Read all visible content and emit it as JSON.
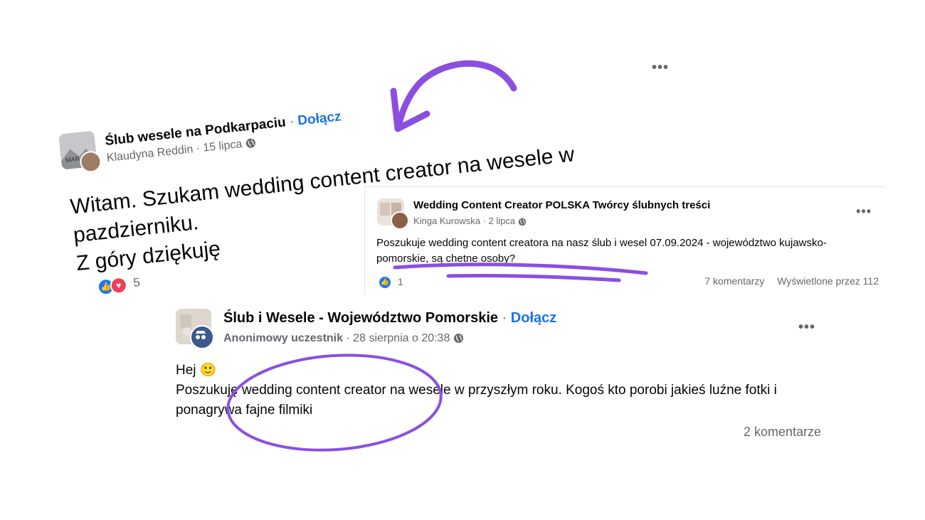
{
  "post1": {
    "group": "Ślub wesele na Podkarpaciu",
    "separator": " · ",
    "join": "Dołącz",
    "author": "Klaudyna Reddin",
    "date": "15 lipca",
    "body_line1": "Witam. Szukam wedding content creator na wesele w",
    "body_line2": "pazdzierniku.",
    "body_line3": "Z góry dziękuję",
    "reaction_count": "5"
  },
  "post2": {
    "group": "Wedding Content Creator POLSKA Twórcy ślubnych treści",
    "author": "Kinga Kurowska",
    "date": "2 lipca",
    "body": "Poszukuje wedding content creatora na nasz ślub i wesel 07.09.2024 - województwo kujawsko-pomorskie, są chetne osoby?",
    "like_count": "1",
    "comments": "7 komentarzy",
    "views": "Wyświetlone przez 112"
  },
  "post3": {
    "group": "Ślub i Wesele - Województwo Pomorskie",
    "separator": " · ",
    "join": "Dołącz",
    "author": "Anonimowy uczestnik",
    "date": "28 sierpnia o 20:38",
    "greeting": "Hej",
    "emoji": "🙂",
    "body": "Poszukuję wedding content creator na wesele w przyszłym roku. Kogoś kto porobi jakieś luźne fotki i ponagrywa fajne filmiki",
    "comments": "2 komentarze"
  },
  "icons": {
    "more": "•••",
    "like": "👍",
    "heart": "♥"
  },
  "colors": {
    "accent": "#8b4fe0",
    "link": "#1b74e4",
    "like": "#1877f2",
    "heart": "#f33e58"
  }
}
